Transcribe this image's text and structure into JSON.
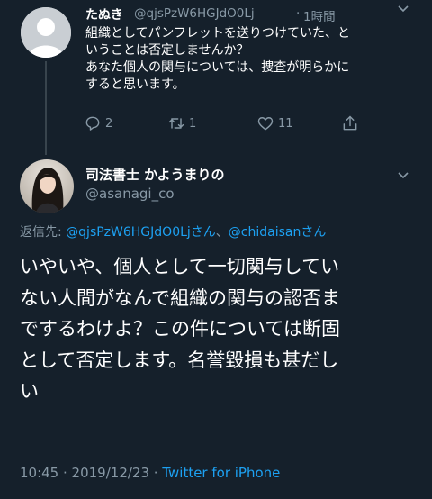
{
  "parent_tweet": {
    "display_name": "たぬき",
    "handle": "@qjsPzW6HGJdO0Lj",
    "separator": "·",
    "time": "1時間",
    "text_lines": [
      "組織としてパンフレットを送りつけていた、と",
      "いうことは否定しませんか？",
      "あなた個人の関与については、捜査が明らかに",
      "すると思います。"
    ],
    "actions": {
      "reply": {
        "icon": "reply-icon",
        "count": "2"
      },
      "retweet": {
        "icon": "retweet-icon",
        "count": "1"
      },
      "like": {
        "icon": "heart-icon",
        "count": "11"
      },
      "share": {
        "icon": "share-icon"
      }
    }
  },
  "main_tweet": {
    "display_name": "司法書士 かようまりの",
    "handle": "@asanagi_co",
    "reply_to": {
      "prefix": "返信先: ",
      "mention1": "@qjsPzW6HGJdO0Ljさん",
      "separator": "、",
      "mention2": "@chidaisanさん"
    },
    "text_lines": [
      "いやいや、個人として一切関与してい",
      "ない人間がなんで組織の関与の認否ま",
      "でするわけよ？この件については断固",
      "として否定します。名誉毀損も甚だし",
      "い"
    ],
    "meta": {
      "time": "10:45",
      "separator": " · ",
      "date": "2019/12/23",
      "separator2": " · ",
      "client": "Twitter for iPhone"
    }
  },
  "colors": {
    "background": "#15202b",
    "text": "#ffffff",
    "muted": "#8899a6",
    "link": "#1da1f2",
    "divider": "#38444d"
  }
}
